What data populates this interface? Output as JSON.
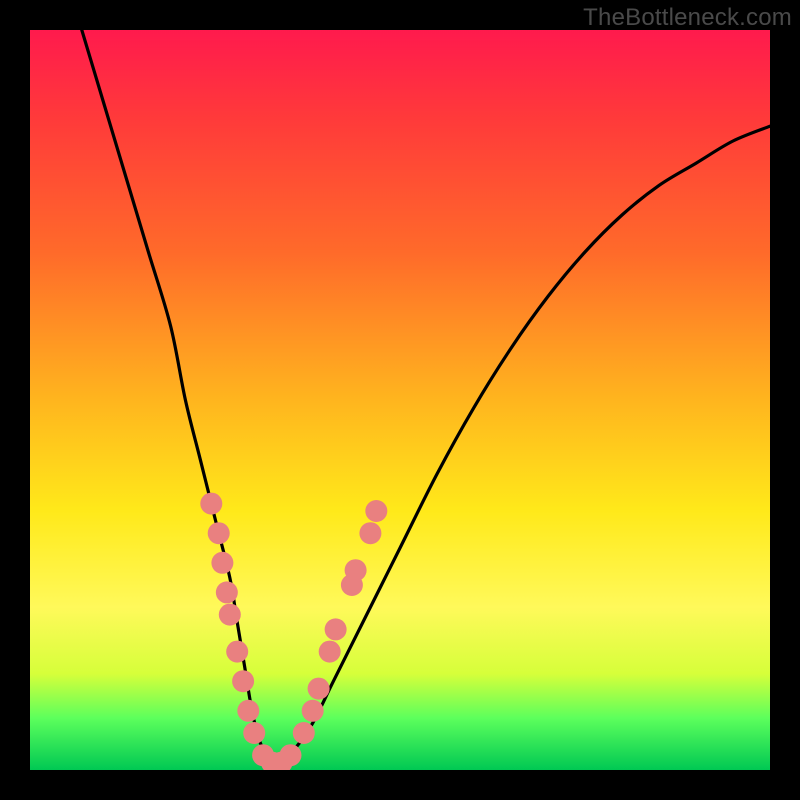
{
  "watermark": {
    "text": "TheBottleneck.com"
  },
  "chart_data": {
    "type": "line",
    "title": "",
    "xlabel": "",
    "ylabel": "",
    "xlim": [
      0,
      100
    ],
    "ylim": [
      0,
      100
    ],
    "grid": false,
    "background": "rainbow-gradient",
    "series": [
      {
        "name": "bottleneck-curve",
        "x": [
          7,
          10,
          13,
          16,
          19,
          21,
          23,
          25,
          27,
          28,
          29,
          30,
          31,
          32,
          33,
          35,
          38,
          41,
          45,
          50,
          55,
          60,
          65,
          70,
          75,
          80,
          85,
          90,
          95,
          100
        ],
        "y": [
          100,
          90,
          80,
          70,
          60,
          50,
          42,
          34,
          26,
          20,
          14,
          8,
          4,
          2,
          1,
          2,
          6,
          12,
          20,
          30,
          40,
          49,
          57,
          64,
          70,
          75,
          79,
          82,
          85,
          87
        ]
      }
    ],
    "markers": [
      {
        "x": 24.5,
        "y": 36
      },
      {
        "x": 25.5,
        "y": 32
      },
      {
        "x": 26.0,
        "y": 28
      },
      {
        "x": 26.6,
        "y": 24
      },
      {
        "x": 27.0,
        "y": 21
      },
      {
        "x": 28.0,
        "y": 16
      },
      {
        "x": 28.8,
        "y": 12
      },
      {
        "x": 29.5,
        "y": 8
      },
      {
        "x": 30.3,
        "y": 5
      },
      {
        "x": 31.5,
        "y": 2
      },
      {
        "x": 32.7,
        "y": 1
      },
      {
        "x": 34.0,
        "y": 1
      },
      {
        "x": 35.2,
        "y": 2
      },
      {
        "x": 37.0,
        "y": 5
      },
      {
        "x": 38.2,
        "y": 8
      },
      {
        "x": 39.0,
        "y": 11
      },
      {
        "x": 40.5,
        "y": 16
      },
      {
        "x": 41.3,
        "y": 19
      },
      {
        "x": 43.5,
        "y": 25
      },
      {
        "x": 44.0,
        "y": 27
      },
      {
        "x": 46.0,
        "y": 32
      },
      {
        "x": 46.8,
        "y": 35
      }
    ],
    "marker_style": {
      "color": "#e98080",
      "radius": 11
    }
  }
}
